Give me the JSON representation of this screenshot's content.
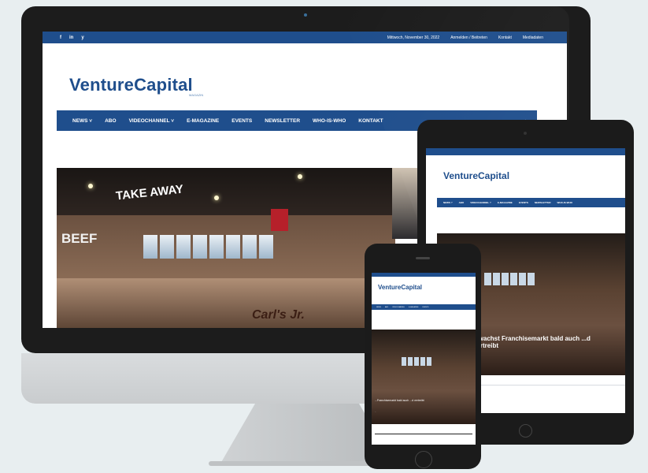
{
  "desktop": {
    "social_icons": [
      "f",
      "in",
      "y"
    ],
    "topbar_links": [
      "Mittwoch, November 30, 2022",
      "Anmelden / Beitreten",
      "Kontakt",
      "Mediadaten"
    ],
    "logo": {
      "name": "VentureCapital",
      "tagline": "MAGAZIN"
    },
    "nav_items": [
      "NEWS ˅",
      "ABO",
      "VIDEOCHANNEL ˅",
      "E-MAGAZINE",
      "EVENTS",
      "NEWSLETTER",
      "WHO-IS-WHO",
      "KONTAKT"
    ],
    "hero": {
      "sign_text": "TAKE AWAY",
      "wall_text": "BEEF",
      "brand_text": "Carl's Jr."
    }
  },
  "tablet": {
    "logo": "VentureCapital",
    "nav_items": [
      "NEWS ˅",
      "ABO",
      "VIDEOCHANNEL ˅",
      "E-MAGAZINE",
      "EVENTS",
      "NEWSLETTER",
      "WHO-IS-WHO"
    ],
    "headline": "...wachst Franchisemarkt bald auch ...d vertreibt",
    "meta": "..."
  },
  "phone": {
    "logo": "VentureCapital",
    "nav_items": [
      "NEWS",
      "ABO",
      "VIDEOCHANNEL",
      "E-MAGAZINE",
      "EVENTS"
    ],
    "headline": "...Franchisemarkt bald auch ...d vertreibt",
    "meta": "..."
  }
}
